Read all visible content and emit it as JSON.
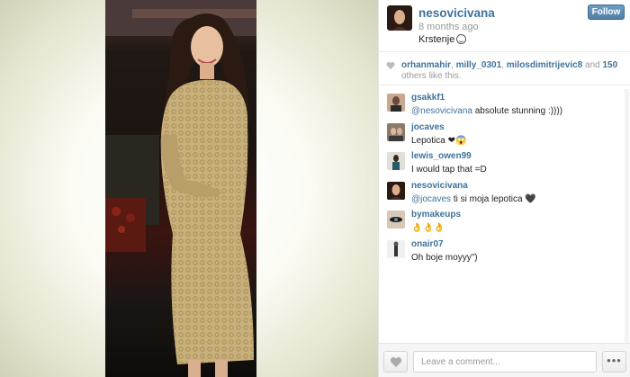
{
  "post": {
    "username": "nesovicivana",
    "time_ago": "8 months ago",
    "caption": "Krstenje",
    "follow_label": "Follow"
  },
  "likes": {
    "user1": "orhanmahir",
    "user2": "milly_0301",
    "user3": "milosdimitrijevic8",
    "and_text": "and",
    "count": "150",
    "others_text": "others like this."
  },
  "comments": [
    {
      "user": "gsakkf1",
      "mention": "@nesovicivana",
      "text": " absolute stunning :))))"
    },
    {
      "user": "jocaves",
      "mention": "",
      "text": "Lepotica ❤😱"
    },
    {
      "user": "lewis_owen99",
      "mention": "",
      "text": "I would tap that =D"
    },
    {
      "user": "nesovicivana",
      "mention": "@jocaves",
      "text": " ti si moja lepotica 🖤"
    },
    {
      "user": "bymakeups",
      "mention": "",
      "text": "👌👌👌"
    },
    {
      "user": "onair07",
      "mention": "",
      "text": "Oh boje moyyy\")"
    }
  ],
  "footer": {
    "comment_placeholder": "Leave a comment...",
    "more_label": "•••"
  },
  "icons": {
    "heart": "heart-icon",
    "more": "ellipsis-icon"
  },
  "colors": {
    "link": "#3f729b",
    "follow_button": "#517fa4"
  }
}
